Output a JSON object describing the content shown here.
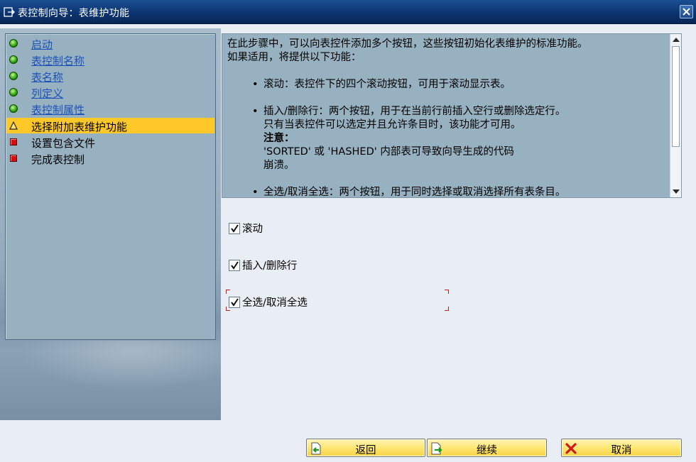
{
  "window": {
    "title": "表控制向导：表维护功能"
  },
  "steps": [
    {
      "label": "启动",
      "status": "done"
    },
    {
      "label": "表控制名称",
      "status": "done"
    },
    {
      "label": "表名称",
      "status": "done"
    },
    {
      "label": "列定义",
      "status": "done"
    },
    {
      "label": "表控制属性",
      "status": "done"
    },
    {
      "label": "选择附加表维护功能",
      "status": "current"
    },
    {
      "label": "设置包含文件",
      "status": "todo"
    },
    {
      "label": "完成表控制",
      "status": "todo"
    }
  ],
  "description": {
    "intro_1": "在此步骤中，可以向表控件添加多个按钮，这些按钮初始化表维护的标准功能。",
    "intro_2": "如果适用，将提供以下功能：",
    "bullets": [
      {
        "lines": [
          "滚动：表控件下的四个滚动按钮，可用于滚动显示表。"
        ]
      },
      {
        "lines": [
          "插入/删除行：两个按钮，用于在当前行前插入空行或删除选定行。",
          "只有当表控件可以选定并且允许条目时，该功能才可用。"
        ],
        "note_label": "注意：",
        "note_lines": [
          "'SORTED' 或 'HASHED' 内部表可导致向导生成的代码",
          "崩溃。"
        ]
      },
      {
        "lines": [
          "全选/取消全选：两个按钮，用于同时选择或取消选择所有表条目。"
        ]
      }
    ]
  },
  "options": [
    {
      "label": "滚动",
      "checked": true
    },
    {
      "label": "插入/删除行",
      "checked": true
    },
    {
      "label": "全选/取消全选",
      "checked": true
    }
  ],
  "buttons": {
    "back": "返回",
    "continue": "继续",
    "cancel": "取消"
  },
  "colors": {
    "title_bar": "#0c3470",
    "current_step": "#ffc829",
    "done_link": "#1c52b8",
    "button_face": "#ffe56c"
  }
}
